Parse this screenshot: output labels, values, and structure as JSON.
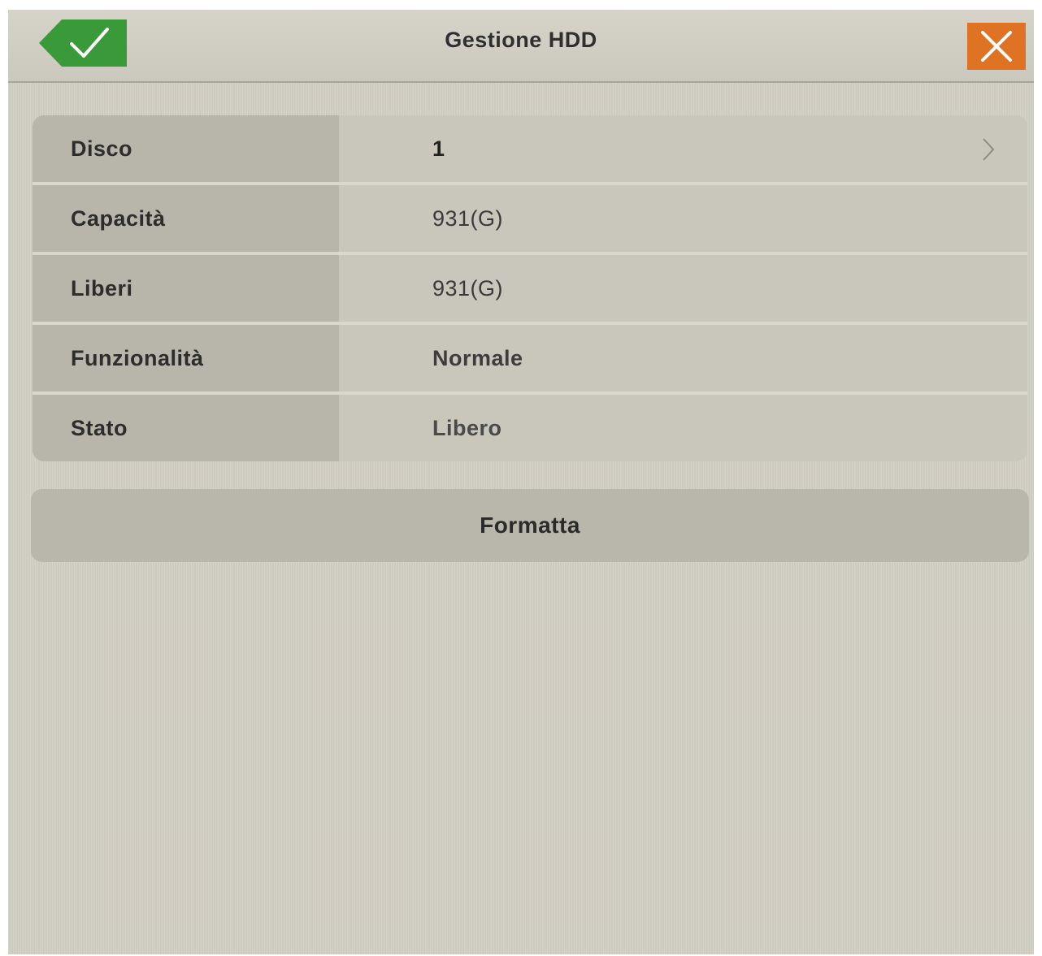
{
  "header": {
    "title": "Gestione HDD",
    "confirm_icon": "check-icon",
    "close_icon": "close-icon"
  },
  "disk_info": [
    {
      "label": "Disco",
      "value": "1",
      "has_chevron": true
    },
    {
      "label": "Capacità",
      "value": "931(G)"
    },
    {
      "label": "Liberi",
      "value": "931(G)"
    },
    {
      "label": "Funzionalità",
      "value": "Normale"
    },
    {
      "label": "Stato",
      "value": "Libero"
    }
  ],
  "actions": {
    "format_label": "Formatta"
  },
  "colors": {
    "confirm_green": "#3a9a3a",
    "close_orange": "#e07224",
    "background": "#d4d1c6"
  }
}
